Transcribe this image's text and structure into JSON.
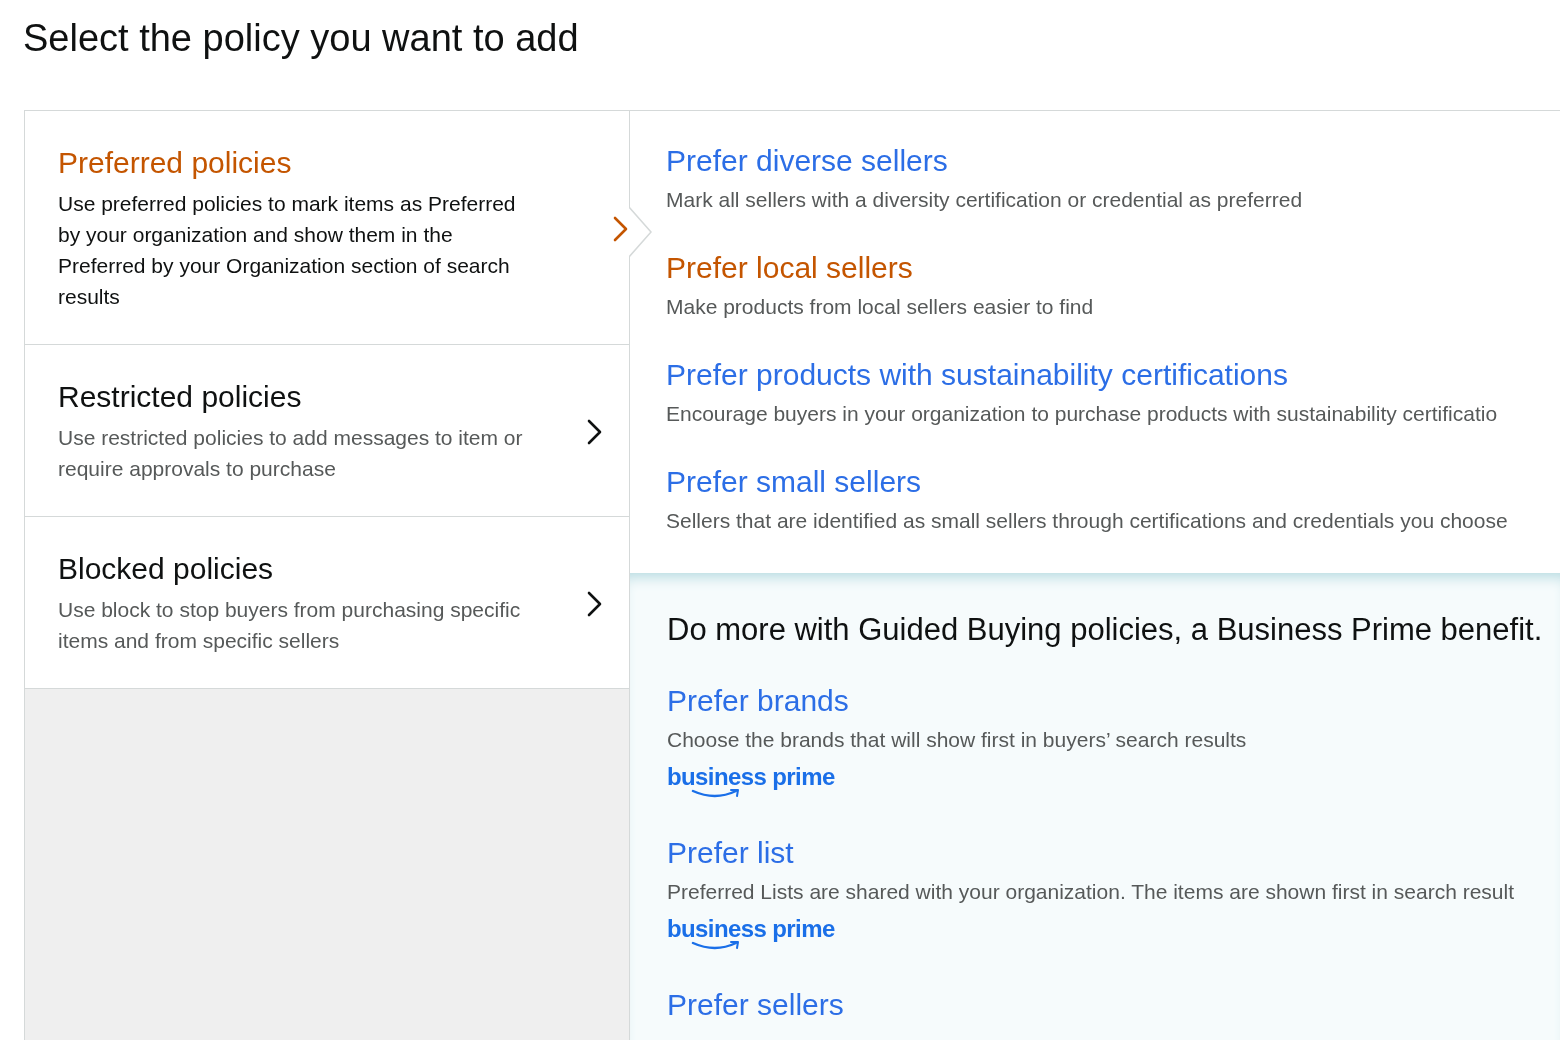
{
  "page": {
    "title": "Select the policy you want to add"
  },
  "categories": [
    {
      "title": "Preferred policies",
      "description": "Use preferred policies to mark items as Preferred by your organization and show them in the Preferred by your Organization section of search results",
      "selected": true
    },
    {
      "title": "Restricted policies",
      "description": "Use restricted policies to add messages to item or require approvals to purchase",
      "selected": false
    },
    {
      "title": "Blocked policies",
      "description": "Use block to stop buyers from purchasing specific items and from specific sellers",
      "selected": false
    }
  ],
  "policies": [
    {
      "title": "Prefer diverse sellers",
      "description": "Mark all sellers with a diversity certification or credential as preferred",
      "highlighted": false
    },
    {
      "title": "Prefer local sellers",
      "description": "Make products from local sellers easier to find",
      "highlighted": true
    },
    {
      "title": "Prefer products with sustainability certifications",
      "description": "Encourage buyers in your organization to purchase products with sustainability certificatio",
      "highlighted": false
    },
    {
      "title": "Prefer small sellers",
      "description": "Sellers that are identified as small sellers through certifications and credentials you choose",
      "highlighted": false
    }
  ],
  "guided_buying": {
    "heading": "Do more with Guided Buying policies, a Business Prime benefit.",
    "policies": [
      {
        "title": "Prefer brands",
        "description": "Choose the brands that will show first in buyers’ search results",
        "badge": "business prime"
      },
      {
        "title": "Prefer list",
        "description": "Preferred Lists are shared with your organization. The items are shown first in search result",
        "badge": "business prime"
      },
      {
        "title": "Prefer sellers"
      }
    ]
  }
}
